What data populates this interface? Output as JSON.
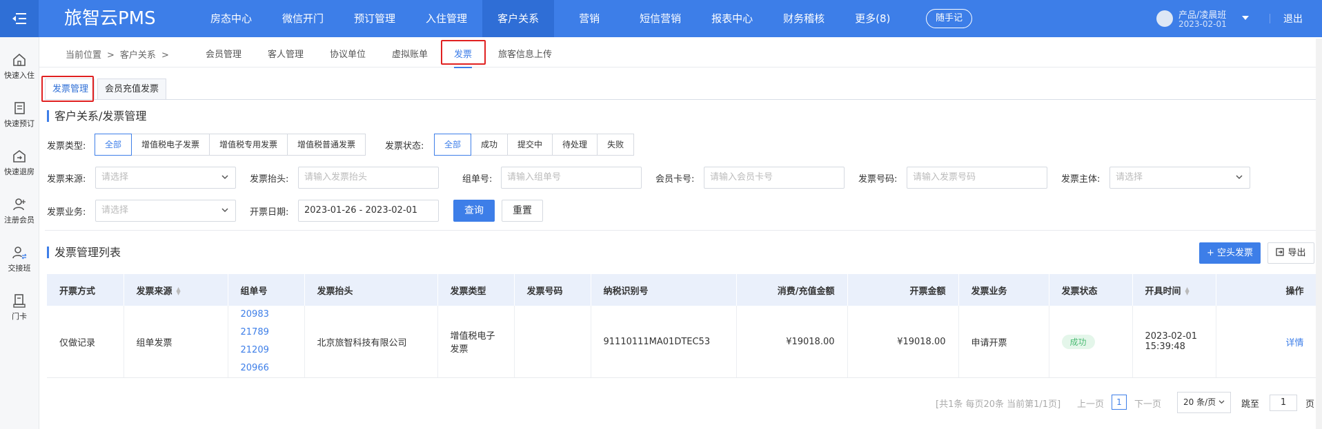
{
  "brand": "旅智云PMS",
  "nav": [
    "房态中心",
    "微信开门",
    "预订管理",
    "入住管理",
    "客户关系",
    "营销",
    "短信营销",
    "报表中心",
    "财务稽核",
    "更多(8)"
  ],
  "nav_active": 4,
  "note_btn": "随手记",
  "user": {
    "name": "产品/凌晨班",
    "date": "2023-02-01",
    "logout": "退出"
  },
  "sidebar": [
    "快速入住",
    "快速预订",
    "快速退房",
    "注册会员",
    "交接班",
    "门卡"
  ],
  "breadcrumb": {
    "label": "当前位置",
    "sep": ">",
    "path": "客户关系"
  },
  "subtabs": [
    "会员管理",
    "客人管理",
    "协议单位",
    "虚拟账单",
    "发票",
    "旅客信息上传"
  ],
  "tabs": [
    "发票管理",
    "会员充值发票"
  ],
  "page_title": "客户关系/发票管理",
  "filters": {
    "invoice_type": {
      "label": "发票类型:",
      "options": [
        "全部",
        "增值税电子发票",
        "增值税专用发票",
        "增值税普通发票"
      ]
    },
    "invoice_status": {
      "label": "发票状态:",
      "options": [
        "全部",
        "成功",
        "提交中",
        "待处理",
        "失败"
      ]
    },
    "source": {
      "label": "发票来源:",
      "placeholder": "请选择"
    },
    "header": {
      "label": "发票抬头:",
      "placeholder": "请输入发票抬头"
    },
    "order_no": {
      "label": "组单号:",
      "placeholder": "请输入组单号"
    },
    "member_card": {
      "label": "会员卡号:",
      "placeholder": "请输入会员卡号"
    },
    "invoice_no": {
      "label": "发票号码:",
      "placeholder": "请输入发票号码"
    },
    "subject": {
      "label": "发票主体:",
      "placeholder": "请选择"
    },
    "business": {
      "label": "发票业务:",
      "placeholder": "请选择"
    },
    "date": {
      "label": "开票日期:",
      "value": "2023-01-26 - 2023-02-01"
    },
    "query": "查询",
    "reset": "重置"
  },
  "list": {
    "title": "发票管理列表",
    "add_btn": "+ 空头发票",
    "export_btn": "导出"
  },
  "table": {
    "headers": [
      "开票方式",
      "发票来源",
      "组单号",
      "发票抬头",
      "发票类型",
      "发票号码",
      "纳税识别号",
      "消费/充值金额",
      "开票金额",
      "发票业务",
      "发票状态",
      "开具时间",
      "操作"
    ],
    "rows": [
      {
        "method": "仅做记录",
        "source": "组单发票",
        "orders": [
          "20983",
          "21789",
          "21209",
          "20966"
        ],
        "title": "北京旅智科技有限公司",
        "type": "增值税电子发票",
        "number": "",
        "tax_id": "91110111MA01DTEC53",
        "consume": "¥19018.00",
        "amount": "¥19018.00",
        "business": "申请开票",
        "status": "成功",
        "time": "2023-02-01 15:39:48",
        "action": "详情"
      }
    ]
  },
  "pager": {
    "info": "[共1条 每页20条 当前第1/1页]",
    "prev": "上一页",
    "current": "1",
    "next": "下一页",
    "size": "20 条/页",
    "jump": "跳至",
    "page": "1",
    "unit": "页"
  }
}
